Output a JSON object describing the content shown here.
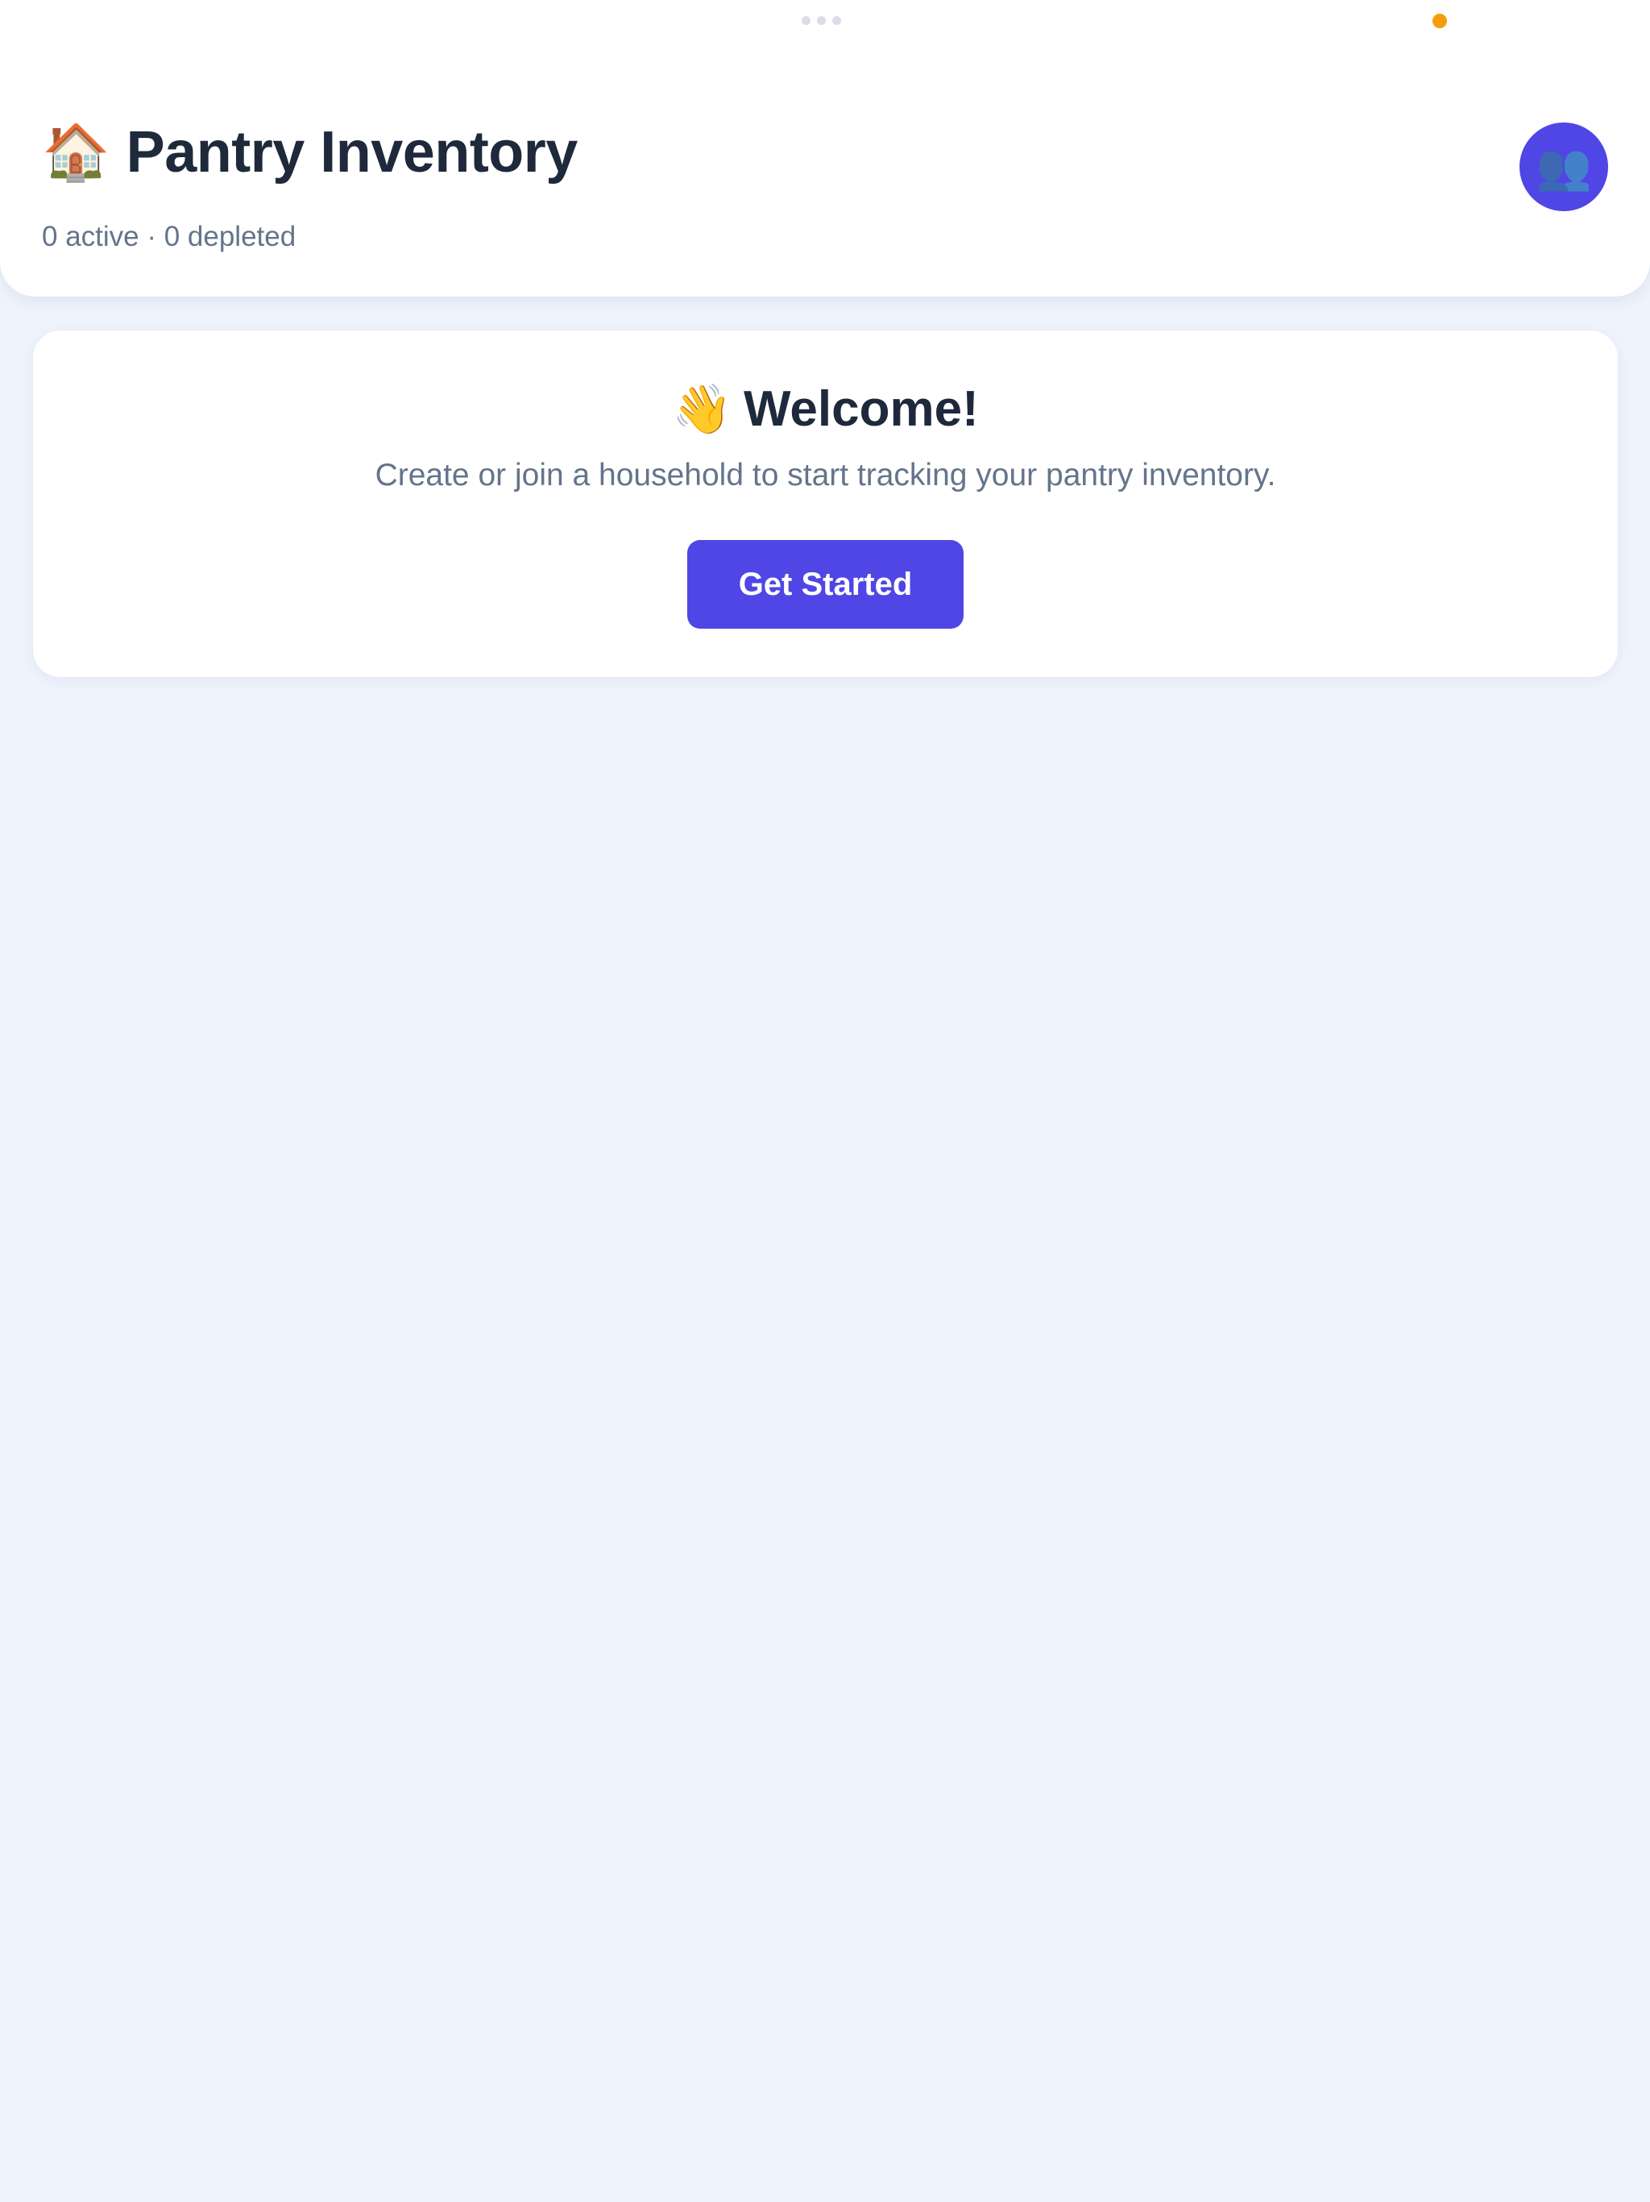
{
  "header": {
    "house_icon": "🏠",
    "title": "Pantry Inventory",
    "subtitle": "0 active · 0 depleted",
    "avatar_icon": "👥"
  },
  "welcome": {
    "wave_icon": "👋",
    "heading": "Welcome!",
    "description": "Create or join a household to start tracking your pantry inventory.",
    "button_label": "Get Started"
  },
  "colors": {
    "accent": "#4f46e5",
    "background": "#eef3fd",
    "title_text": "#1e293b",
    "muted_text": "#64748b",
    "privacy_indicator": "#f59e0b"
  }
}
